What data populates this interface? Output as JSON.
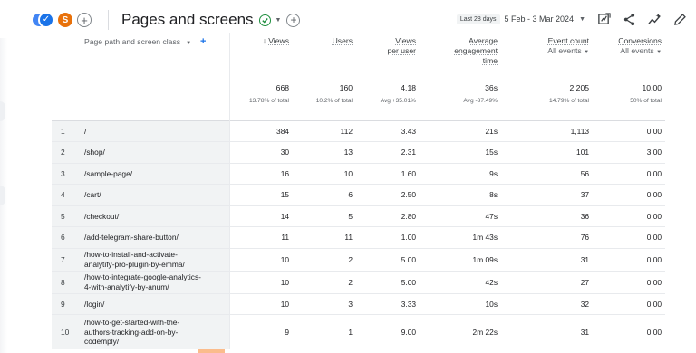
{
  "header": {
    "s_chip": "S",
    "title": "Pages and screens",
    "date_badge": "Last 28 days",
    "date_range": "5 Feb - 3 Mar 2024"
  },
  "table": {
    "headers": {
      "dimension": "Page path and screen class",
      "views": "Views",
      "users": "Users",
      "views_per_user_1": "Views",
      "views_per_user_2": "per user",
      "engagement_1": "Average",
      "engagement_2": "engagement",
      "engagement_3": "time",
      "event_count": "Event count",
      "event_count_filter": "All events",
      "conversions": "Conversions",
      "conversions_filter": "All events"
    },
    "totals": {
      "views": "668",
      "views_sub": "13.78% of total",
      "users": "160",
      "users_sub": "10.2% of total",
      "vpu": "4.18",
      "vpu_sub": "Avg +35.01%",
      "eng": "36s",
      "eng_sub": "Avg -37.49%",
      "events": "2,205",
      "events_sub": "14.79% of total",
      "conv": "10.00",
      "conv_sub": "50% of total"
    },
    "rows": [
      {
        "n": "1",
        "path": "/",
        "views": "384",
        "users": "112",
        "vpu": "3.43",
        "eng": "21s",
        "events": "1,113",
        "conv": "0.00"
      },
      {
        "n": "2",
        "path": "/shop/",
        "views": "30",
        "users": "13",
        "vpu": "2.31",
        "eng": "15s",
        "events": "101",
        "conv": "3.00"
      },
      {
        "n": "3",
        "path": "/sample-page/",
        "views": "16",
        "users": "10",
        "vpu": "1.60",
        "eng": "9s",
        "events": "56",
        "conv": "0.00"
      },
      {
        "n": "4",
        "path": "/cart/",
        "views": "15",
        "users": "6",
        "vpu": "2.50",
        "eng": "8s",
        "events": "37",
        "conv": "0.00"
      },
      {
        "n": "5",
        "path": "/checkout/",
        "views": "14",
        "users": "5",
        "vpu": "2.80",
        "eng": "47s",
        "events": "36",
        "conv": "0.00"
      },
      {
        "n": "6",
        "path": "/add-telegram-share-button/",
        "views": "11",
        "users": "11",
        "vpu": "1.00",
        "eng": "1m 43s",
        "events": "76",
        "conv": "0.00"
      },
      {
        "n": "7",
        "path_1": "/how-to-install-and-activate-",
        "path_2": "analytify-pro-plugin-by-emma/",
        "views": "10",
        "users": "2",
        "vpu": "5.00",
        "eng": "1m 09s",
        "events": "31",
        "conv": "0.00"
      },
      {
        "n": "8",
        "path_1": "/how-to-integrate-google-analytics-",
        "path_2": "4-with-analytify-by-anum/",
        "views": "10",
        "users": "2",
        "vpu": "5.00",
        "eng": "42s",
        "events": "27",
        "conv": "0.00"
      },
      {
        "n": "9",
        "path": "/login/",
        "views": "10",
        "users": "3",
        "vpu": "3.33",
        "eng": "10s",
        "events": "32",
        "conv": "0.00"
      },
      {
        "n": "10",
        "path_1": "/how-to-get-started-with-the-",
        "path_2": "authors-tracking-add-on-by-",
        "path_3": "codemply/",
        "views": "9",
        "users": "1",
        "vpu": "9.00",
        "eng": "2m 22s",
        "events": "31",
        "conv": "0.00"
      }
    ]
  },
  "icons": [
    "checkmark-icon",
    "plus-icon",
    "check-circle-icon",
    "caret-down-icon",
    "customize-report-icon",
    "share-icon",
    "insights-icon",
    "edit-icon",
    "sort-arrow-down-icon"
  ],
  "colors": {
    "accent": "#1a73e8",
    "check": "#1e8e3e",
    "chip": "#e8710a"
  }
}
